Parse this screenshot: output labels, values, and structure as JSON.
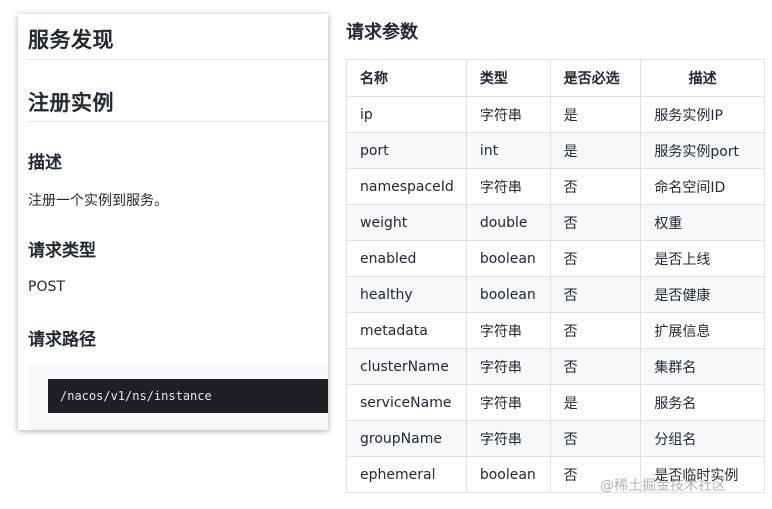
{
  "left_doc": {
    "title_service_discovery": "服务发现",
    "title_register_instance": "注册实例",
    "heading_description": "描述",
    "description_text": "注册一个实例到服务。",
    "heading_request_type": "请求类型",
    "request_type_value": "POST",
    "heading_request_path": "请求路径",
    "request_path_value": "/nacos/v1/ns/instance"
  },
  "params": {
    "title": "请求参数",
    "headers": [
      "名称",
      "类型",
      "是否必选",
      "描述"
    ],
    "rows": [
      {
        "name": "ip",
        "type": "字符串",
        "required": "是",
        "desc": "服务实例IP"
      },
      {
        "name": "port",
        "type": "int",
        "required": "是",
        "desc": "服务实例port"
      },
      {
        "name": "namespaceId",
        "type": "字符串",
        "required": "否",
        "desc": "命名空间ID"
      },
      {
        "name": "weight",
        "type": "double",
        "required": "否",
        "desc": "权重"
      },
      {
        "name": "enabled",
        "type": "boolean",
        "required": "否",
        "desc": "是否上线"
      },
      {
        "name": "healthy",
        "type": "boolean",
        "required": "否",
        "desc": "是否健康"
      },
      {
        "name": "metadata",
        "type": "字符串",
        "required": "否",
        "desc": "扩展信息"
      },
      {
        "name": "clusterName",
        "type": "字符串",
        "required": "否",
        "desc": "集群名"
      },
      {
        "name": "serviceName",
        "type": "字符串",
        "required": "是",
        "desc": "服务名"
      },
      {
        "name": "groupName",
        "type": "字符串",
        "required": "否",
        "desc": "分组名"
      },
      {
        "name": "ephemeral",
        "type": "boolean",
        "required": "否",
        "desc": "是否临时实例"
      }
    ]
  },
  "watermark": "@稀土掘金技术社区"
}
